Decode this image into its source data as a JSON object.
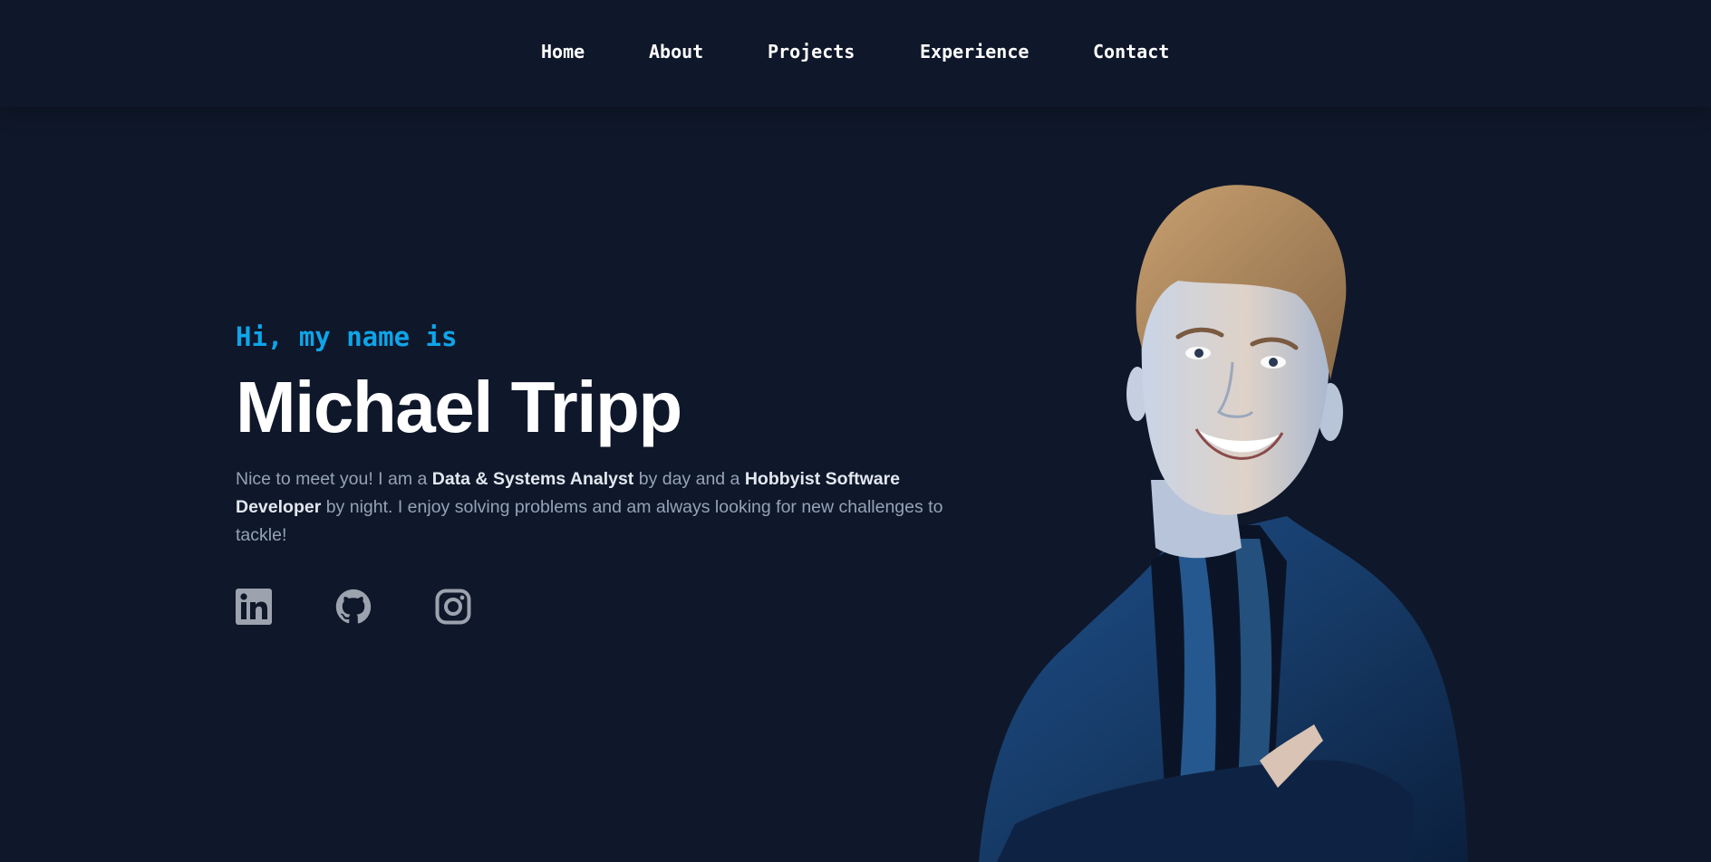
{
  "nav": {
    "items": [
      {
        "label": "Home"
      },
      {
        "label": "About"
      },
      {
        "label": "Projects"
      },
      {
        "label": "Experience"
      },
      {
        "label": "Contact"
      }
    ]
  },
  "hero": {
    "greeting": "Hi, my name is",
    "name": "Michael Tripp",
    "intro": {
      "part1": "Nice to meet you! I am a ",
      "role1": "Data & Systems Analyst",
      "part2": " by day and a ",
      "role2": "Hobbyist Software Developer",
      "part3": " by night. I enjoy solving problems and am always looking for new challenges to tackle!"
    }
  },
  "socials": [
    {
      "icon": "linkedin-icon"
    },
    {
      "icon": "github-icon"
    },
    {
      "icon": "instagram-icon"
    }
  ],
  "colors": {
    "background": "#0f172a",
    "accent": "#0ea5e9",
    "text": "#ffffff",
    "muted": "#94a3b8",
    "icon": "#9ca3af"
  }
}
